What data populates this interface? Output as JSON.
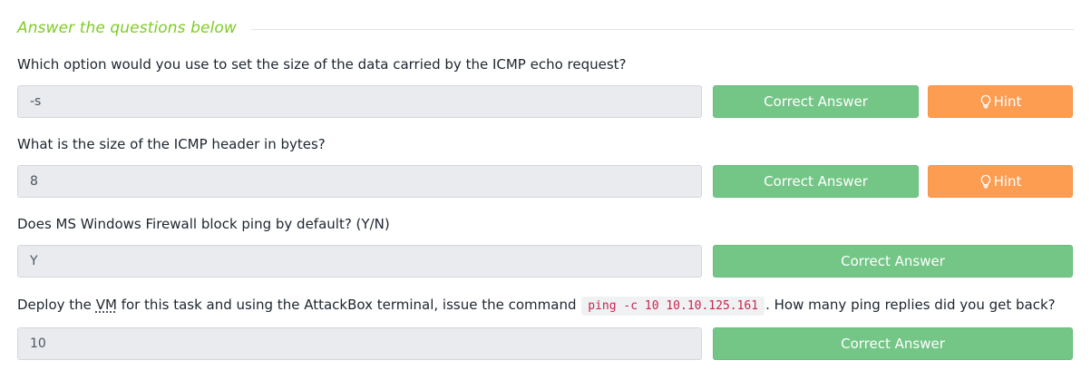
{
  "section": {
    "title": "Answer the questions below"
  },
  "questions": [
    {
      "text": "Which option would you use to set the size of the data carried by the ICMP echo request?",
      "answer": "-s",
      "correct_label": "Correct Answer",
      "hint_label": "Hint"
    },
    {
      "text": "What is the size of the ICMP header in bytes?",
      "answer": "8",
      "correct_label": "Correct Answer",
      "hint_label": "Hint"
    },
    {
      "text": "Does MS Windows Firewall block ping by default? (Y/N)",
      "answer": "Y",
      "correct_label": "Correct Answer"
    },
    {
      "text_before": "Deploy the ",
      "abbr": "VM",
      "text_middle": " for this task and using the AttackBox terminal, issue the command ",
      "code": "ping -c 10 10.10.125.161",
      "text_after": ". How many ping replies did you get back?",
      "answer": "10",
      "correct_label": "Correct Answer"
    }
  ],
  "icons": {
    "hint": "lightbulb-icon"
  },
  "colors": {
    "section_title": "#7fcb27",
    "correct_button": "#73c686",
    "hint_button": "#fd9d52",
    "code_text": "#c7254e"
  }
}
